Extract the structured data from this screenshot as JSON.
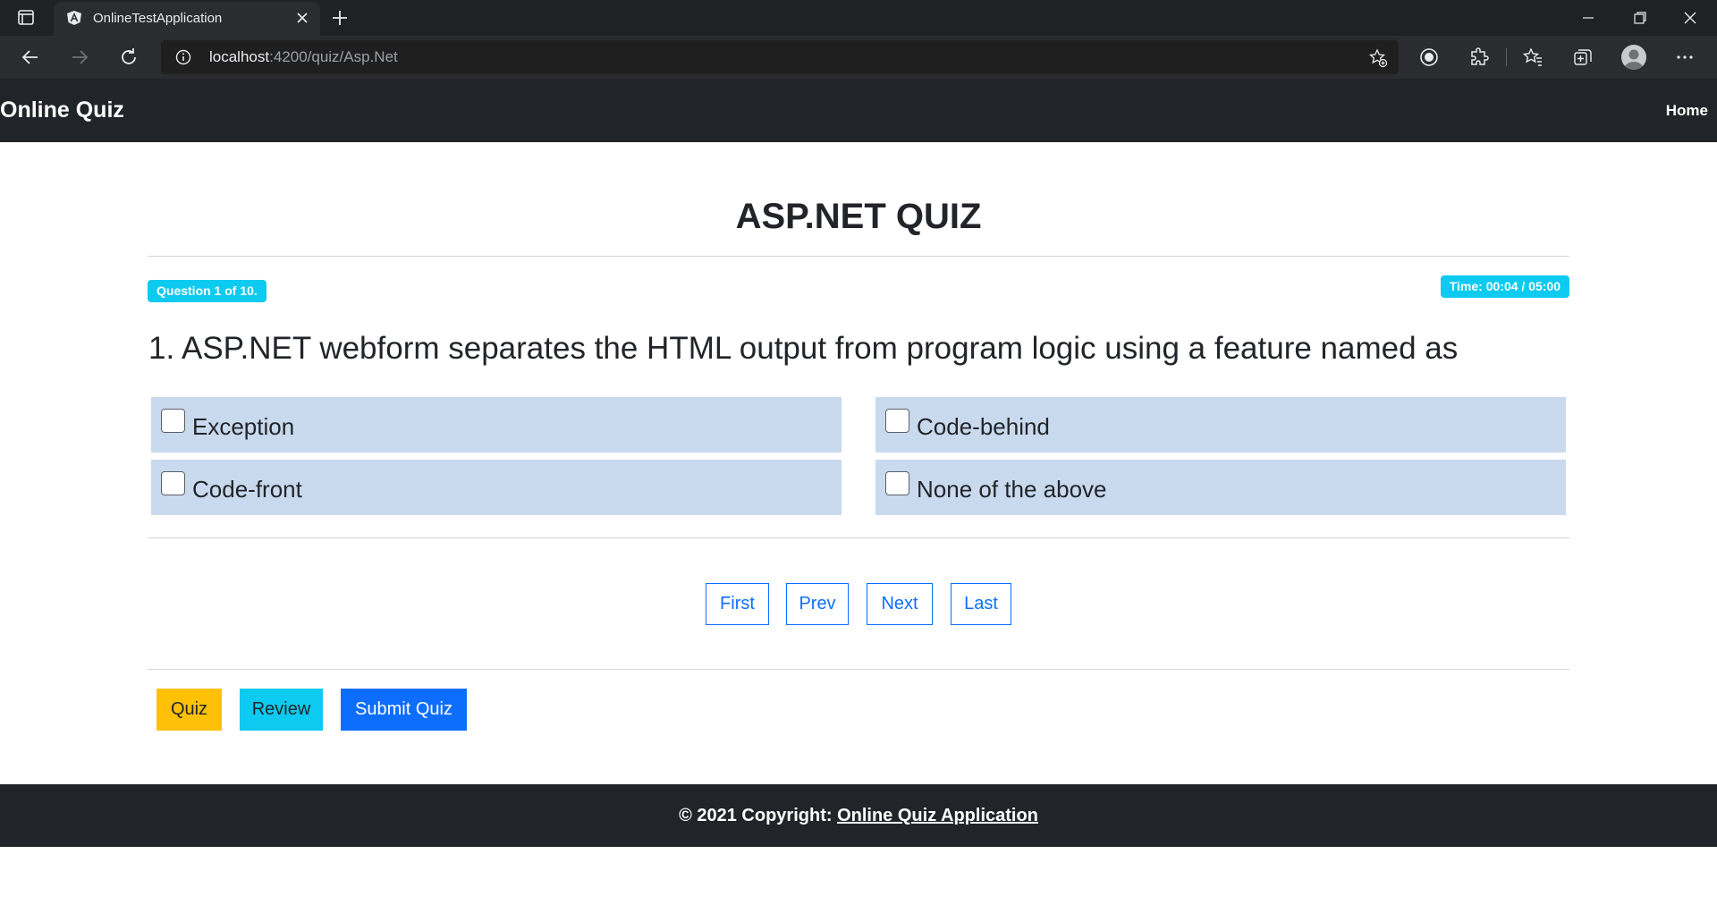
{
  "browser": {
    "tab_title": "OnlineTestApplication",
    "url_host": "localhost",
    "url_path": ":4200/quiz/Asp.Net"
  },
  "navbar": {
    "brand": "Online Quiz",
    "home_link": "Home"
  },
  "quiz": {
    "title": "ASP.NET QUIZ",
    "question_badge": "Question 1 of 10.",
    "time_badge": "Time: 00:04 / 05:00",
    "question_text": "1. ASP.NET webform separates the HTML output from program logic using a feature named as",
    "options": [
      {
        "label": "Exception",
        "checked": false
      },
      {
        "label": "Code-behind",
        "checked": false
      },
      {
        "label": "Code-front",
        "checked": false
      },
      {
        "label": "None of the above",
        "checked": false
      }
    ]
  },
  "pager": {
    "first": "First",
    "prev": "Prev",
    "next": "Next",
    "last": "Last"
  },
  "actions": {
    "quiz": "Quiz",
    "review": "Review",
    "submit": "Submit Quiz"
  },
  "footer": {
    "copyright": "© 2021 Copyright: ",
    "link": "Online Quiz Application"
  },
  "colors": {
    "navbar_bg": "#212529",
    "badge_info": "#0dcaf0",
    "option_bg": "#c9d9ee",
    "primary": "#0d6efd",
    "warning": "#ffc107"
  },
  "icons": {
    "tab": "angular-icon",
    "info": "info-icon",
    "favorites_add": "star-plus-icon",
    "extensions": "puzzle-icon",
    "collections": "collections-icon",
    "menu": "more-icon"
  }
}
